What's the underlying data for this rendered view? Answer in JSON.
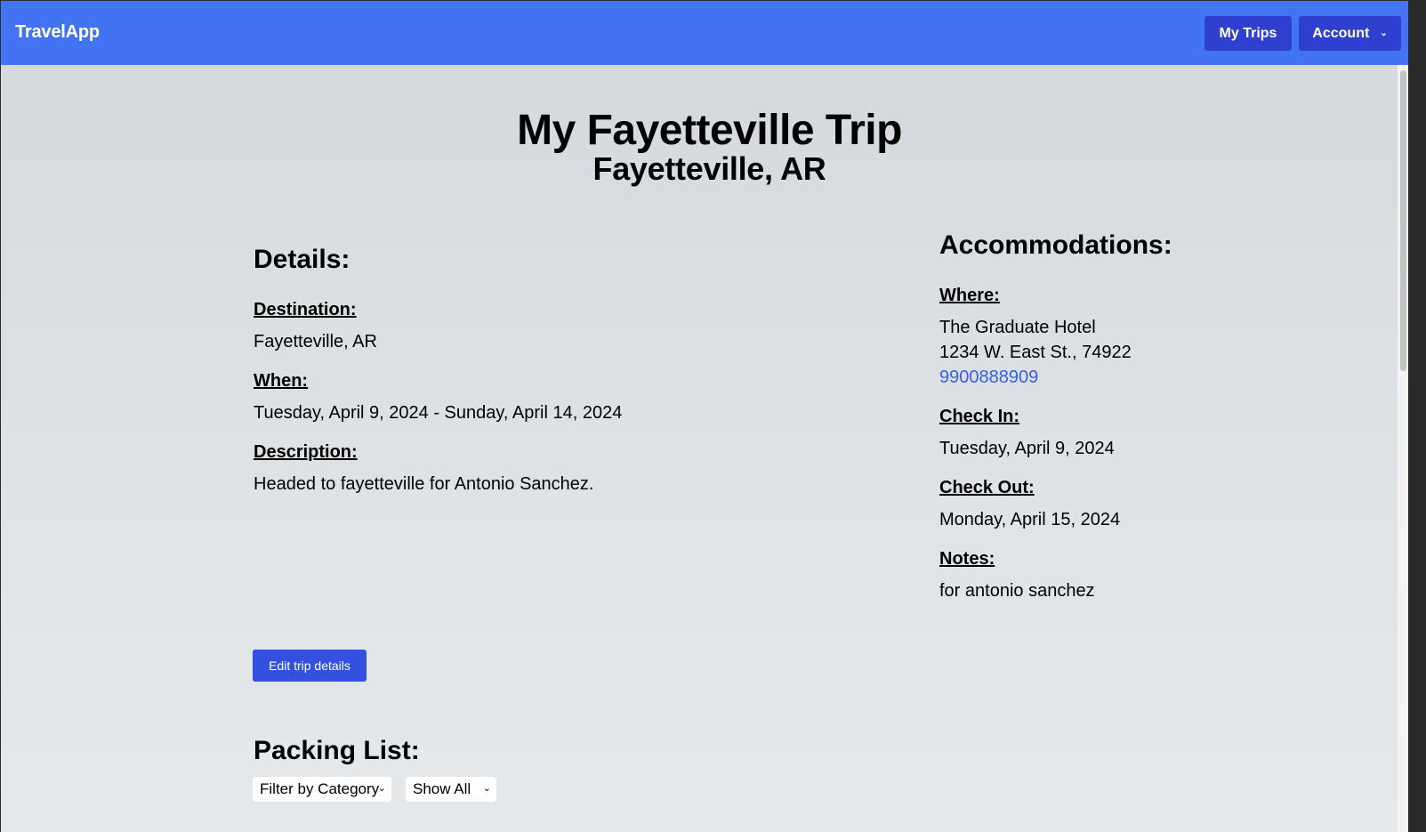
{
  "navbar": {
    "brand": "TravelApp",
    "my_trips_label": "My Trips",
    "account_label": "Account"
  },
  "trip": {
    "title": "My Fayetteville Trip",
    "subtitle": "Fayetteville, AR"
  },
  "details": {
    "heading": "Details:",
    "destination_label": "Destination:",
    "destination_value": "Fayetteville, AR",
    "when_label": "When:",
    "when_value": "Tuesday, April 9, 2024 - Sunday, April 14, 2024",
    "description_label": "Description:",
    "description_value": "Headed to fayetteville for Antonio Sanchez."
  },
  "accommodations": {
    "heading": "Accommodations:",
    "where_label": "Where:",
    "hotel_name": "The Graduate Hotel",
    "address": "1234 W. East St., 74922",
    "phone": "9900888909",
    "checkin_label": "Check In:",
    "checkin_value": "Tuesday, April 9, 2024",
    "checkout_label": "Check Out:",
    "checkout_value": "Monday, April 15, 2024",
    "notes_label": "Notes:",
    "notes_value": "for antonio sanchez"
  },
  "actions": {
    "edit_label": "Edit trip details"
  },
  "packing": {
    "heading": "Packing List:",
    "category_filter": "Filter by Category",
    "show_filter": "Show All"
  },
  "colors": {
    "navbar": "#4273f2",
    "nav_button": "#2f3fd0",
    "primary_button": "#3350e0",
    "link": "#3b5ce6"
  }
}
